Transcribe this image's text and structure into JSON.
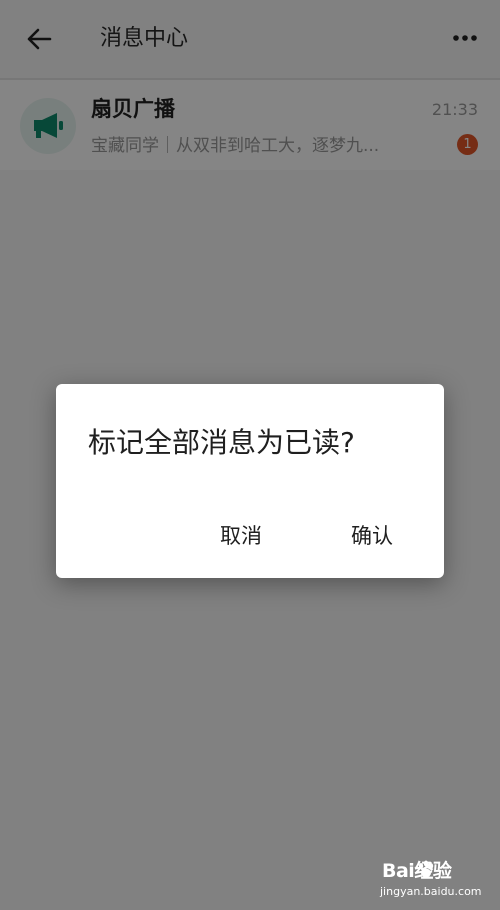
{
  "header": {
    "title": "消息中心",
    "back_icon": "back-arrow-icon",
    "more_icon": "more-dots-icon"
  },
  "messages": [
    {
      "title": "扇贝广播",
      "time": "21:33",
      "preview": "宝藏同学｜从双非到哈工大，逐梦九...",
      "unread_count": "1",
      "icon": "megaphone-icon"
    }
  ],
  "dialog": {
    "title": "标记全部消息为已读?",
    "cancel_label": "取消",
    "confirm_label": "确认"
  },
  "watermark": {
    "logo_text": "Bai经验",
    "url": "jingyan.baidu.com"
  },
  "colors": {
    "accent": "#0f8a6c",
    "badge": "#e2572a",
    "overlay": "rgba(0,0,0,0.48)"
  }
}
